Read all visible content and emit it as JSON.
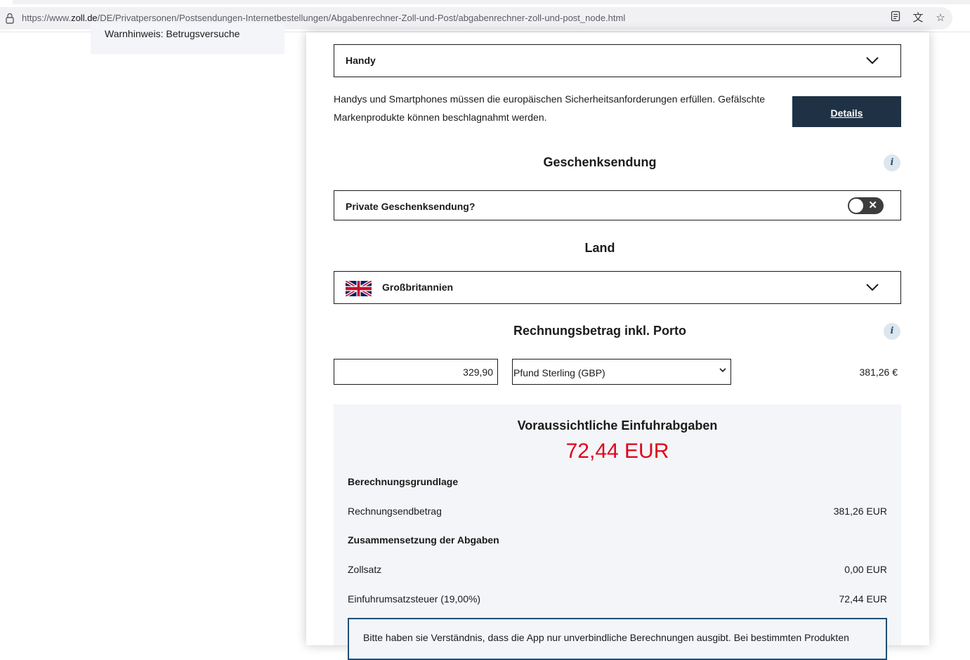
{
  "browser": {
    "url_prefix": "https://www.",
    "url_host": "zoll.de",
    "url_path": "/DE/Privatpersonen/Postsendungen-Internetbestellungen/Abgabenrechner-Zoll-und-Post/abgabenrechner-zoll-und-post_node.html"
  },
  "sidebar": {
    "item_label": "Warnhinweis: Betrugsversuche"
  },
  "category": {
    "selected": "Handy",
    "info_text": "Handys und Smartphones müssen die europäischen Sicherheitsanforderungen erfüllen. Gefälschte Markenprodukte können beschlagnahmt werden.",
    "details_label": "Details"
  },
  "gift": {
    "section_title": "Geschenksendung",
    "toggle_label": "Private Geschenksendung?",
    "toggle_on": false
  },
  "country": {
    "section_title": "Land",
    "selected": "Großbritannien"
  },
  "invoice": {
    "section_title": "Rechnungsbetrag inkl. Porto",
    "amount": "329,90",
    "currency": "Pfund Sterling (GBP)",
    "converted": "381,26 €"
  },
  "result": {
    "title": "Voraussichtliche Einfuhrabgaben",
    "total": "72,44 EUR",
    "basis_heading": "Berechnungsgrundlage",
    "rows_basis": [
      {
        "label": "Rechnungsendbetrag",
        "value": "381,26 EUR"
      }
    ],
    "composition_heading": "Zusammensetzung der Abgaben",
    "rows_composition": [
      {
        "label": "Zollsatz",
        "value": "0,00 EUR"
      },
      {
        "label": "Einfuhrumsatzsteuer (19,00%)",
        "value": "72,44 EUR"
      }
    ],
    "notice": "Bitte haben sie Verständnis, dass die App nur unverbindliche Berechnungen ausgibt. Bei bestimmten Produkten"
  },
  "colors": {
    "accent_dark": "#1f3144",
    "total_red": "#e2001a",
    "result_bg": "#f3f5f8"
  }
}
